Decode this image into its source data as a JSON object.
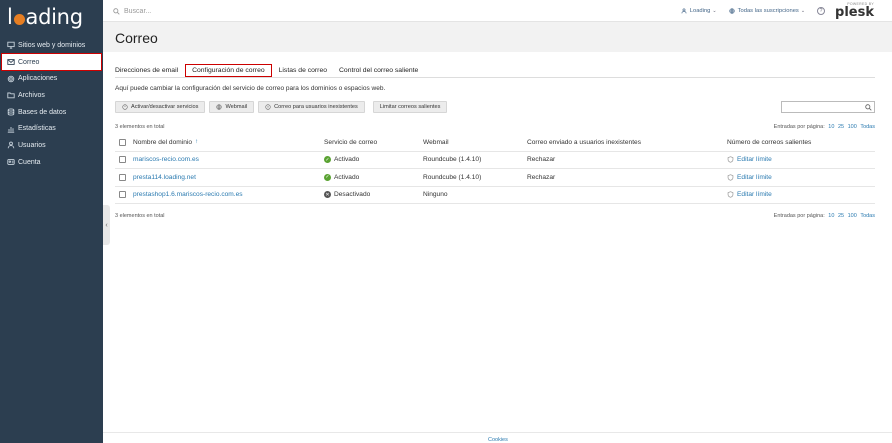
{
  "brand": {
    "logo_text_pre": "l",
    "logo_text_post": "ading"
  },
  "sidebar": {
    "items": [
      {
        "label": "Sitios web y dominios",
        "icon": "monitor-icon"
      },
      {
        "label": "Correo",
        "icon": "mail-icon",
        "active": true
      },
      {
        "label": "Aplicaciones",
        "icon": "gear-icon"
      },
      {
        "label": "Archivos",
        "icon": "folder-icon"
      },
      {
        "label": "Bases de datos",
        "icon": "database-icon"
      },
      {
        "label": "Estadísticas",
        "icon": "chart-icon"
      },
      {
        "label": "Usuarios",
        "icon": "user-icon"
      },
      {
        "label": "Cuenta",
        "icon": "account-icon"
      }
    ],
    "collapse_glyph": "‹"
  },
  "topbar": {
    "search_placeholder": "Buscar...",
    "user_label": "Loading",
    "subscriptions_label": "Todas las suscripciones",
    "help_glyph": "?",
    "powered_by": "POWERED BY",
    "product": "plesk"
  },
  "page": {
    "title": "Correo",
    "tabs": [
      {
        "label": "Direcciones de email"
      },
      {
        "label": "Configuración de correo",
        "active": true
      },
      {
        "label": "Listas de correo"
      },
      {
        "label": "Control del correo saliente"
      }
    ],
    "description": "Aquí puede cambiar la configuración del servicio de correo para los dominios o espacios web.",
    "toolbar": {
      "toggle_services": "Activar/desactivar servicios",
      "webmail": "Webmail",
      "nonexistent_users": "Correo para usuarios inexistentes",
      "limit_outgoing": "Limitar correos salientes"
    },
    "count_text": "3 elementos en total",
    "per_page_label": "Entradas por página:",
    "per_page_options": [
      "10",
      "25",
      "100",
      "Todas"
    ],
    "table": {
      "headers": {
        "domain": "Nombre del dominio",
        "sort_glyph": "↑",
        "service": "Servicio de correo",
        "webmail": "Webmail",
        "forward": "Correo enviado a usuarios inexistentes",
        "limit": "Número de correos salientes"
      },
      "rows": [
        {
          "domain": "mariscos-recio.com.es",
          "service": "Activado",
          "service_on": true,
          "webmail": "Roundcube (1.4.10)",
          "forward": "Rechazar",
          "limit": "Editar límite"
        },
        {
          "domain": "presta114.loading.net",
          "service": "Activado",
          "service_on": true,
          "webmail": "Roundcube (1.4.10)",
          "forward": "Rechazar",
          "limit": "Editar límite"
        },
        {
          "domain": "prestashop1.6.mariscos-recio.com.es",
          "service": "Desactivado",
          "service_on": false,
          "webmail": "Ninguno",
          "forward": "",
          "limit": "Editar límite"
        }
      ]
    },
    "footer_link": "Cookies"
  }
}
